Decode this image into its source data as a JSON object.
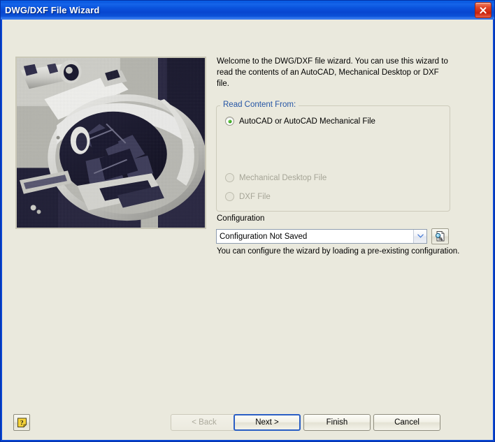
{
  "window": {
    "title": "DWG/DXF File Wizard",
    "close_icon": "close-icon",
    "background_color": "#eae9dd",
    "titlebar_color": "#0a51db"
  },
  "preview": {
    "name": "machine-photo",
    "alt": "Photograph of machinery"
  },
  "main": {
    "intro_text": "Welcome to the DWG/DXF file wizard. You can use this wizard to read the contents of an AutoCAD, Mechanical Desktop or DXF file.",
    "groupbox": {
      "legend": "Read Content From:",
      "legend_color": "#2555a5",
      "options": [
        {
          "label": "AutoCAD or AutoCAD Mechanical File",
          "checked": true,
          "enabled": true
        },
        {
          "label": "Mechanical Desktop File",
          "checked": false,
          "enabled": false
        },
        {
          "label": "DXF File",
          "checked": false,
          "enabled": false
        }
      ]
    },
    "configuration": {
      "label": "Configuration",
      "selected_value": "Configuration Not Saved",
      "dropdown_icon": "chevron-down-icon",
      "browse_icon": "document-search-icon",
      "hint": "You can configure the wizard by loading a pre-existing configuration."
    }
  },
  "footer": {
    "help_icon": "help-question-icon",
    "buttons": [
      {
        "label": "< Back",
        "enabled": false,
        "default": false
      },
      {
        "label": "Next >",
        "enabled": true,
        "default": true
      },
      {
        "label": "Finish",
        "enabled": true,
        "default": false
      },
      {
        "label": "Cancel",
        "enabled": true,
        "default": false
      }
    ]
  }
}
